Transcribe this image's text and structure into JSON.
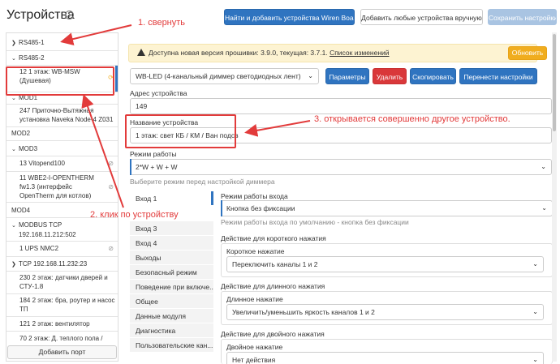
{
  "header": {
    "title": "Устройства",
    "info_icon": "info-circle-icon",
    "btn_find": "Найти и добавить устройства Wiren Board",
    "btn_add_manual": "Добавить любые устройства вручную",
    "btn_save": "Сохранить настройки"
  },
  "sidebar": {
    "items": [
      {
        "label": "RS485-1"
      },
      {
        "label": "RS485-2"
      },
      {
        "line1": "12 1 этаж: WB-MSW",
        "line2": "(Душевая)"
      },
      {
        "label": "MOD1"
      },
      {
        "line1": "247 Приточно-Вытяжная",
        "line2": "установка Naveka Node-4 Z031"
      },
      {
        "label": "MOD2"
      },
      {
        "label": "MOD3"
      },
      {
        "label": "13 Vitopend100"
      },
      {
        "line1": "11 WBE2-I-OPENTHERM",
        "line2": "fw1.3 (интерфейс",
        "line3": "OpenTherm для котлов)"
      },
      {
        "label": "MOD4"
      },
      {
        "line1": "MODBUS TCP",
        "line2": "192.168.11.212:502"
      },
      {
        "label": "1 UPS NMC2"
      },
      {
        "label": "TCP 192.168.11.232:23"
      },
      {
        "line1": "230 2 этаж: датчики дверей и",
        "line2": "СТУ-1.8"
      },
      {
        "line1": "184 2 этаж: бра, роутер и насос",
        "line2": "ТП"
      },
      {
        "label": "121 2 этаж: вентилятор"
      },
      {
        "label": "70 2 этаж: Д. теплого пола /"
      }
    ],
    "add_port": "Добавить порт"
  },
  "alert": {
    "text_before": "Доступна новая версия прошивки: 3.9.0, текущая: 3.7.1.",
    "link": "Список изменений",
    "button": "Обновить"
  },
  "device": {
    "type_select": "WB-LED (4-канальный диммер светодиодных лент)",
    "btn_params": "Параметры",
    "btn_delete": "Удалить",
    "btn_copy": "Скопировать",
    "btn_transfer": "Перенести настройки",
    "address_label": "Адрес устройства",
    "address_value": "149",
    "name_label": "Название устройства",
    "name_value": "1 этаж: свет КБ / КМ / Ван подсв",
    "mode_label": "Режим работы",
    "mode_value": "2*W + W + W",
    "mode_hint": "Выберите режим перед настройкой диммера"
  },
  "tabs": [
    "Вход 1",
    "Вход 3",
    "Вход 4",
    "Выходы",
    "Безопасный режим",
    "Поведение при включе...",
    "Общее",
    "Данные модуля",
    "Диагностика",
    "Пользовательские кан..."
  ],
  "input_settings": {
    "mode_label": "Режим работы входа",
    "mode_value": "Кнопка без фиксации",
    "mode_hint": "Режим работы входа по умолчанию - кнопка без фиксации",
    "short_label": "Действие для короткого нажатия",
    "short_sub": "Короткое нажатие",
    "short_value": "Переключить каналы 1 и 2",
    "long_label": "Действие для длинного нажатия",
    "long_sub": "Длинное нажатие",
    "long_value": "Увеличить/уменьшить яркость каналов 1 и 2",
    "double_label": "Действие для двойного нажатия",
    "double_sub": "Двойное нажатие",
    "double_value": "Нет действия"
  },
  "annotations": {
    "a1": "1. свернуть",
    "a2": "2. клик по устройству",
    "a3": "3. открывается совершенно другое устройство."
  },
  "colors": {
    "primary": "#2f74c0",
    "danger": "#d9383a",
    "warning": "#f0ad1f",
    "annotation": "#e23b3b"
  }
}
